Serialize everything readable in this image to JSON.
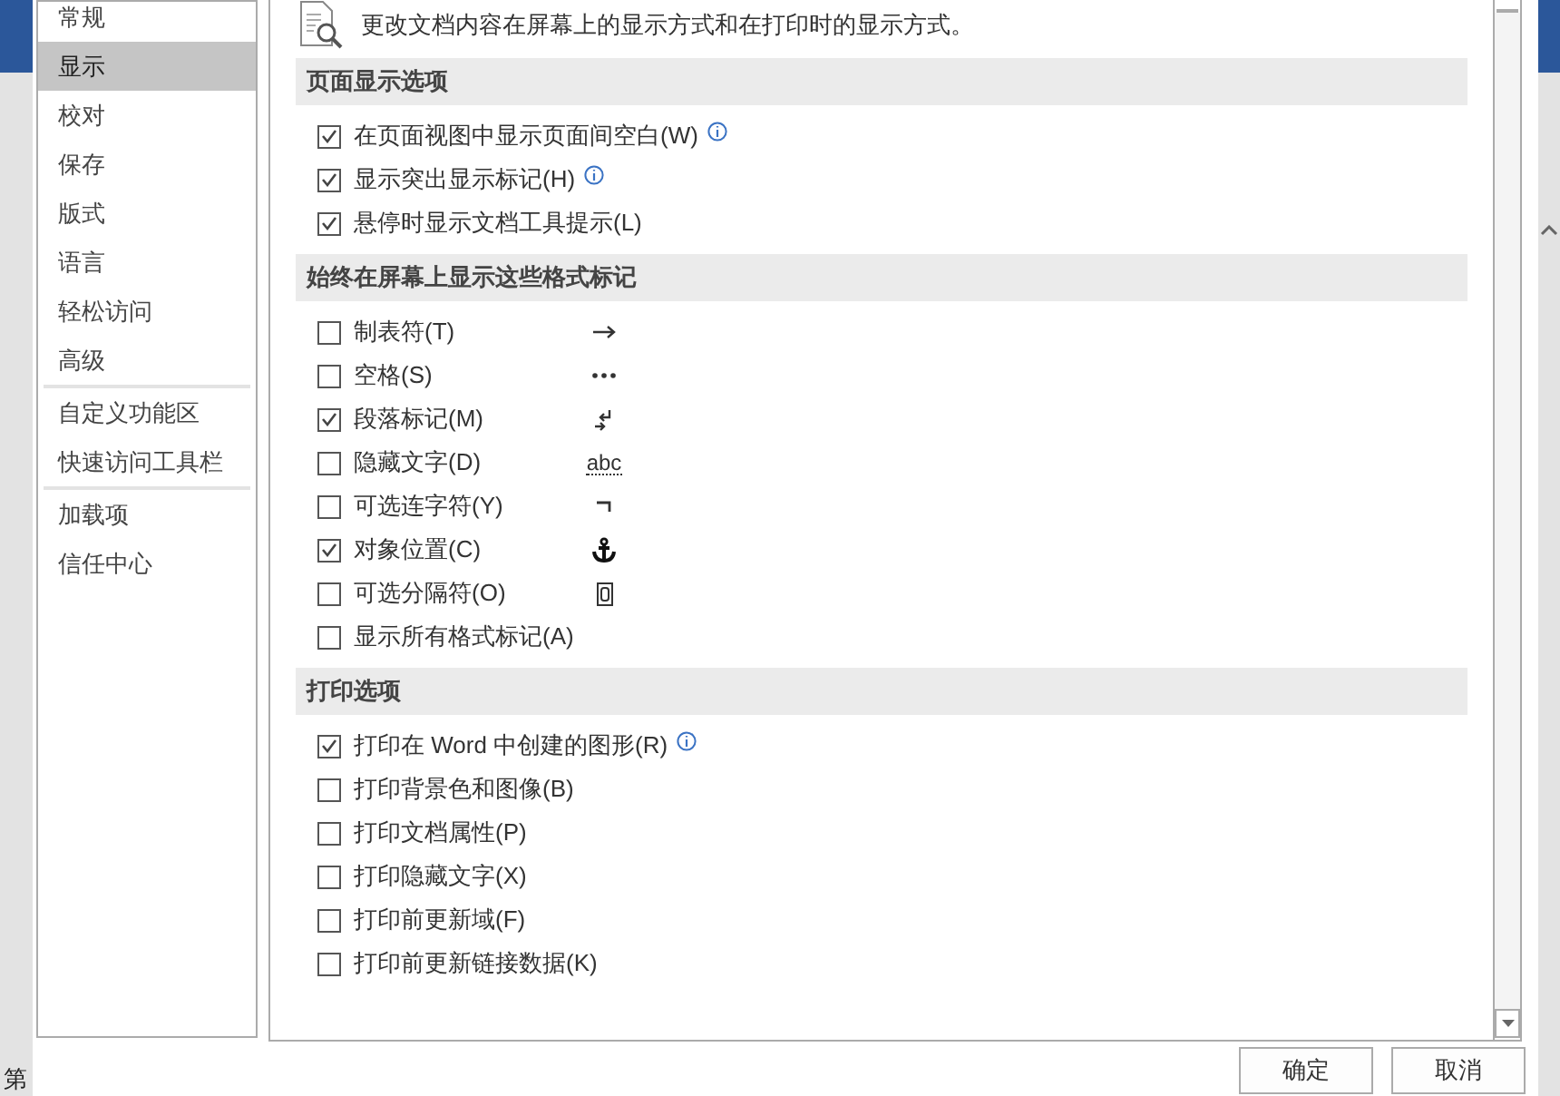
{
  "background": {
    "page_text": "第"
  },
  "sidebar": {
    "groups": [
      [
        {
          "label": "常规",
          "selected": false
        },
        {
          "label": "显示",
          "selected": true
        },
        {
          "label": "校对",
          "selected": false
        },
        {
          "label": "保存",
          "selected": false
        },
        {
          "label": "版式",
          "selected": false
        },
        {
          "label": "语言",
          "selected": false
        },
        {
          "label": "轻松访问",
          "selected": false
        },
        {
          "label": "高级",
          "selected": false
        }
      ],
      [
        {
          "label": "自定义功能区",
          "selected": false
        },
        {
          "label": "快速访问工具栏",
          "selected": false
        }
      ],
      [
        {
          "label": "加载项",
          "selected": false
        },
        {
          "label": "信任中心",
          "selected": false
        }
      ]
    ]
  },
  "header": {
    "text": "更改文档内容在屏幕上的显示方式和在打印时的显示方式。"
  },
  "sections": [
    {
      "title": "页面显示选项",
      "options": [
        {
          "label": "在页面视图中显示页面间空白(W)",
          "checked": true,
          "info": true
        },
        {
          "label": "显示突出显示标记(H)",
          "checked": true,
          "info": true
        },
        {
          "label": "悬停时显示文档工具提示(L)",
          "checked": true,
          "info": false
        }
      ]
    },
    {
      "title": "始终在屏幕上显示这些格式标记",
      "options": [
        {
          "label": "制表符(T)",
          "checked": false,
          "info": false,
          "kind": "arrow"
        },
        {
          "label": "空格(S)",
          "checked": false,
          "info": false,
          "kind": "dots"
        },
        {
          "label": "段落标记(M)",
          "checked": true,
          "info": false,
          "kind": "paragraph"
        },
        {
          "label": "隐藏文字(D)",
          "checked": false,
          "info": false,
          "kind": "text",
          "sample": "abc"
        },
        {
          "label": "可选连字符(Y)",
          "checked": false,
          "info": false,
          "kind": "hyphen"
        },
        {
          "label": "对象位置(C)",
          "checked": true,
          "info": false,
          "kind": "anchor"
        },
        {
          "label": "可选分隔符(O)",
          "checked": false,
          "info": false,
          "kind": "break"
        },
        {
          "label": "显示所有格式标记(A)",
          "checked": false,
          "info": false,
          "kind": "plain"
        }
      ]
    },
    {
      "title": "打印选项",
      "options": [
        {
          "label": "打印在 Word 中创建的图形(R)",
          "checked": true,
          "info": true
        },
        {
          "label": "打印背景色和图像(B)",
          "checked": false,
          "info": false
        },
        {
          "label": "打印文档属性(P)",
          "checked": false,
          "info": false
        },
        {
          "label": "打印隐藏文字(X)",
          "checked": false,
          "info": false
        },
        {
          "label": "打印前更新域(F)",
          "checked": false,
          "info": false
        },
        {
          "label": "打印前更新链接数据(K)",
          "checked": false,
          "info": false
        }
      ]
    }
  ],
  "buttons": [
    "确定",
    "取消"
  ]
}
